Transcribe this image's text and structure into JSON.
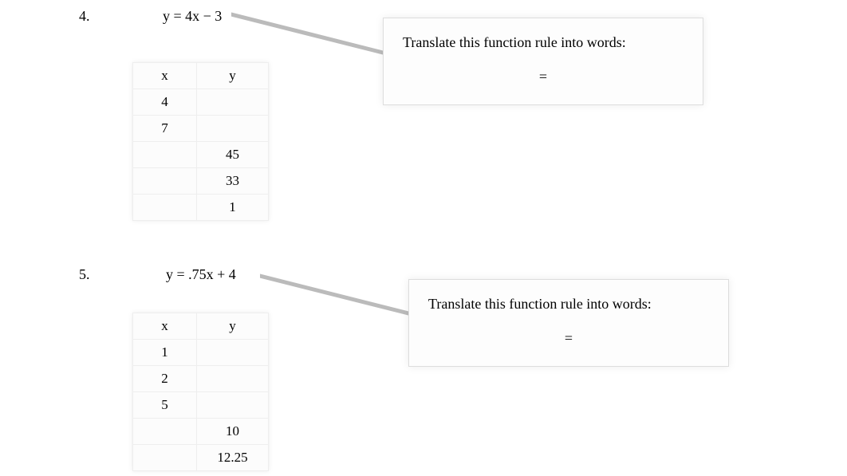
{
  "problems": [
    {
      "number": "4.",
      "equation": "y = 4x − 3",
      "table": {
        "headers": {
          "x": "x",
          "y": "y"
        },
        "rows": [
          {
            "x": "4",
            "y": ""
          },
          {
            "x": "7",
            "y": ""
          },
          {
            "x": "",
            "y": "45"
          },
          {
            "x": "",
            "y": "33"
          },
          {
            "x": "",
            "y": "1"
          }
        ]
      },
      "callout": {
        "title": "Translate this function rule into words:",
        "equals": "="
      }
    },
    {
      "number": "5.",
      "equation": "y = .75x + 4",
      "table": {
        "headers": {
          "x": "x",
          "y": "y"
        },
        "rows": [
          {
            "x": "1",
            "y": ""
          },
          {
            "x": "2",
            "y": ""
          },
          {
            "x": "5",
            "y": ""
          },
          {
            "x": "",
            "y": "10"
          },
          {
            "x": "",
            "y": "12.25"
          }
        ]
      },
      "callout": {
        "title": "Translate this function rule into words:",
        "equals": "="
      }
    }
  ]
}
